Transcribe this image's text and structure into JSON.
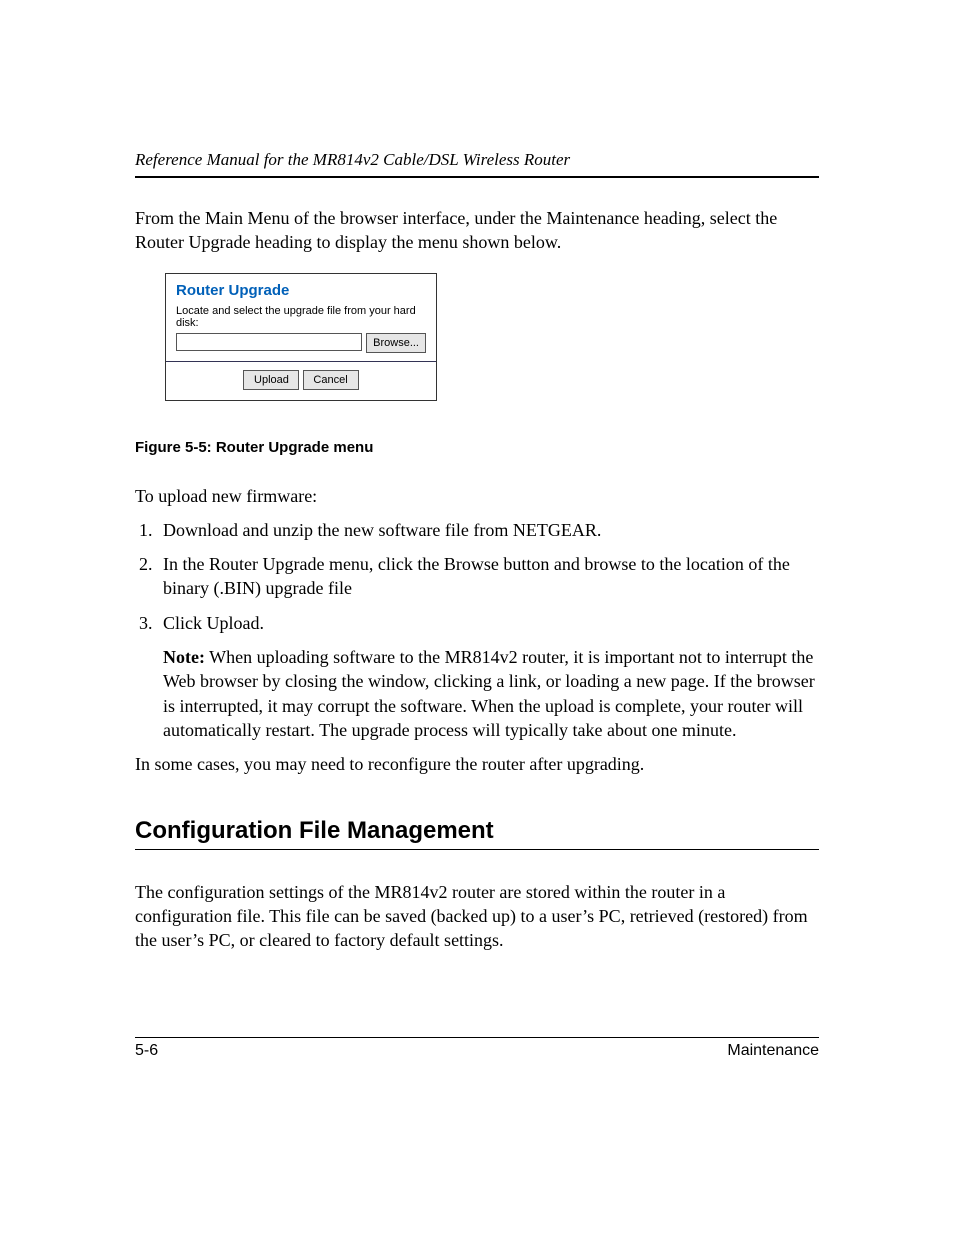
{
  "header": {
    "running": "Reference Manual for the MR814v2 Cable/DSL Wireless Router"
  },
  "intro": "From the Main Menu of the browser interface, under the Maintenance heading, select the Router Upgrade heading to display the menu shown below.",
  "panel": {
    "title": "Router Upgrade",
    "prompt": "Locate and select the upgrade file from your hard disk:",
    "file_value": "",
    "browse": "Browse...",
    "upload": "Upload",
    "cancel": "Cancel"
  },
  "figure_caption": "Figure 5-5:  Router Upgrade menu",
  "upload_intro": "To upload new firmware:",
  "steps": {
    "s1": "Download and unzip the new software file from NETGEAR.",
    "s2": "In the Router Upgrade menu, click the Browse button and browse to the location of the binary (.BIN) upgrade file",
    "s3": "Click Upload.",
    "note_label": "Note:",
    "note_body": " When uploading software to the MR814v2 router, it is important not to interrupt the Web browser by closing the window, clicking a link, or loading a new page. If the browser is interrupted, it may corrupt the software. When the upload is complete, your router will automatically restart. The upgrade process will typically take about one minute."
  },
  "after_steps": "In some cases, you may need to reconfigure the router after upgrading.",
  "section_heading": "Configuration File Management",
  "config_body": "The configuration settings of the MR814v2 router are stored within the router in a configuration file. This file can be saved (backed up) to a user’s PC, retrieved (restored) from the user’s PC, or cleared to factory default settings.",
  "footer": {
    "left": "5-6",
    "right": "Maintenance"
  }
}
